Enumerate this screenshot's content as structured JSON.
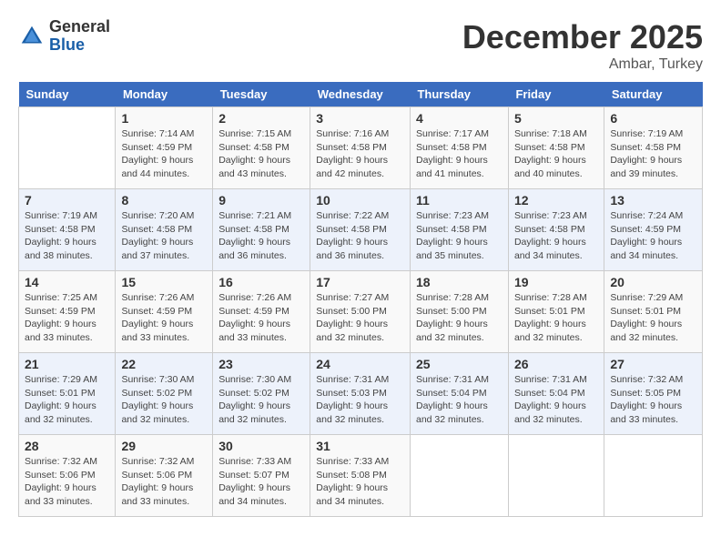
{
  "logo": {
    "general": "General",
    "blue": "Blue"
  },
  "title": "December 2025",
  "location": "Ambar, Turkey",
  "days_of_week": [
    "Sunday",
    "Monday",
    "Tuesday",
    "Wednesday",
    "Thursday",
    "Friday",
    "Saturday"
  ],
  "weeks": [
    [
      {
        "day": "",
        "sunrise": "",
        "sunset": "",
        "daylight": ""
      },
      {
        "day": "1",
        "sunrise": "Sunrise: 7:14 AM",
        "sunset": "Sunset: 4:59 PM",
        "daylight": "Daylight: 9 hours and 44 minutes."
      },
      {
        "day": "2",
        "sunrise": "Sunrise: 7:15 AM",
        "sunset": "Sunset: 4:58 PM",
        "daylight": "Daylight: 9 hours and 43 minutes."
      },
      {
        "day": "3",
        "sunrise": "Sunrise: 7:16 AM",
        "sunset": "Sunset: 4:58 PM",
        "daylight": "Daylight: 9 hours and 42 minutes."
      },
      {
        "day": "4",
        "sunrise": "Sunrise: 7:17 AM",
        "sunset": "Sunset: 4:58 PM",
        "daylight": "Daylight: 9 hours and 41 minutes."
      },
      {
        "day": "5",
        "sunrise": "Sunrise: 7:18 AM",
        "sunset": "Sunset: 4:58 PM",
        "daylight": "Daylight: 9 hours and 40 minutes."
      },
      {
        "day": "6",
        "sunrise": "Sunrise: 7:19 AM",
        "sunset": "Sunset: 4:58 PM",
        "daylight": "Daylight: 9 hours and 39 minutes."
      }
    ],
    [
      {
        "day": "7",
        "sunrise": "Sunrise: 7:19 AM",
        "sunset": "Sunset: 4:58 PM",
        "daylight": "Daylight: 9 hours and 38 minutes."
      },
      {
        "day": "8",
        "sunrise": "Sunrise: 7:20 AM",
        "sunset": "Sunset: 4:58 PM",
        "daylight": "Daylight: 9 hours and 37 minutes."
      },
      {
        "day": "9",
        "sunrise": "Sunrise: 7:21 AM",
        "sunset": "Sunset: 4:58 PM",
        "daylight": "Daylight: 9 hours and 36 minutes."
      },
      {
        "day": "10",
        "sunrise": "Sunrise: 7:22 AM",
        "sunset": "Sunset: 4:58 PM",
        "daylight": "Daylight: 9 hours and 36 minutes."
      },
      {
        "day": "11",
        "sunrise": "Sunrise: 7:23 AM",
        "sunset": "Sunset: 4:58 PM",
        "daylight": "Daylight: 9 hours and 35 minutes."
      },
      {
        "day": "12",
        "sunrise": "Sunrise: 7:23 AM",
        "sunset": "Sunset: 4:58 PM",
        "daylight": "Daylight: 9 hours and 34 minutes."
      },
      {
        "day": "13",
        "sunrise": "Sunrise: 7:24 AM",
        "sunset": "Sunset: 4:59 PM",
        "daylight": "Daylight: 9 hours and 34 minutes."
      }
    ],
    [
      {
        "day": "14",
        "sunrise": "Sunrise: 7:25 AM",
        "sunset": "Sunset: 4:59 PM",
        "daylight": "Daylight: 9 hours and 33 minutes."
      },
      {
        "day": "15",
        "sunrise": "Sunrise: 7:26 AM",
        "sunset": "Sunset: 4:59 PM",
        "daylight": "Daylight: 9 hours and 33 minutes."
      },
      {
        "day": "16",
        "sunrise": "Sunrise: 7:26 AM",
        "sunset": "Sunset: 4:59 PM",
        "daylight": "Daylight: 9 hours and 33 minutes."
      },
      {
        "day": "17",
        "sunrise": "Sunrise: 7:27 AM",
        "sunset": "Sunset: 5:00 PM",
        "daylight": "Daylight: 9 hours and 32 minutes."
      },
      {
        "day": "18",
        "sunrise": "Sunrise: 7:28 AM",
        "sunset": "Sunset: 5:00 PM",
        "daylight": "Daylight: 9 hours and 32 minutes."
      },
      {
        "day": "19",
        "sunrise": "Sunrise: 7:28 AM",
        "sunset": "Sunset: 5:01 PM",
        "daylight": "Daylight: 9 hours and 32 minutes."
      },
      {
        "day": "20",
        "sunrise": "Sunrise: 7:29 AM",
        "sunset": "Sunset: 5:01 PM",
        "daylight": "Daylight: 9 hours and 32 minutes."
      }
    ],
    [
      {
        "day": "21",
        "sunrise": "Sunrise: 7:29 AM",
        "sunset": "Sunset: 5:01 PM",
        "daylight": "Daylight: 9 hours and 32 minutes."
      },
      {
        "day": "22",
        "sunrise": "Sunrise: 7:30 AM",
        "sunset": "Sunset: 5:02 PM",
        "daylight": "Daylight: 9 hours and 32 minutes."
      },
      {
        "day": "23",
        "sunrise": "Sunrise: 7:30 AM",
        "sunset": "Sunset: 5:02 PM",
        "daylight": "Daylight: 9 hours and 32 minutes."
      },
      {
        "day": "24",
        "sunrise": "Sunrise: 7:31 AM",
        "sunset": "Sunset: 5:03 PM",
        "daylight": "Daylight: 9 hours and 32 minutes."
      },
      {
        "day": "25",
        "sunrise": "Sunrise: 7:31 AM",
        "sunset": "Sunset: 5:04 PM",
        "daylight": "Daylight: 9 hours and 32 minutes."
      },
      {
        "day": "26",
        "sunrise": "Sunrise: 7:31 AM",
        "sunset": "Sunset: 5:04 PM",
        "daylight": "Daylight: 9 hours and 32 minutes."
      },
      {
        "day": "27",
        "sunrise": "Sunrise: 7:32 AM",
        "sunset": "Sunset: 5:05 PM",
        "daylight": "Daylight: 9 hours and 33 minutes."
      }
    ],
    [
      {
        "day": "28",
        "sunrise": "Sunrise: 7:32 AM",
        "sunset": "Sunset: 5:06 PM",
        "daylight": "Daylight: 9 hours and 33 minutes."
      },
      {
        "day": "29",
        "sunrise": "Sunrise: 7:32 AM",
        "sunset": "Sunset: 5:06 PM",
        "daylight": "Daylight: 9 hours and 33 minutes."
      },
      {
        "day": "30",
        "sunrise": "Sunrise: 7:33 AM",
        "sunset": "Sunset: 5:07 PM",
        "daylight": "Daylight: 9 hours and 34 minutes."
      },
      {
        "day": "31",
        "sunrise": "Sunrise: 7:33 AM",
        "sunset": "Sunset: 5:08 PM",
        "daylight": "Daylight: 9 hours and 34 minutes."
      },
      {
        "day": "",
        "sunrise": "",
        "sunset": "",
        "daylight": ""
      },
      {
        "day": "",
        "sunrise": "",
        "sunset": "",
        "daylight": ""
      },
      {
        "day": "",
        "sunrise": "",
        "sunset": "",
        "daylight": ""
      }
    ]
  ]
}
